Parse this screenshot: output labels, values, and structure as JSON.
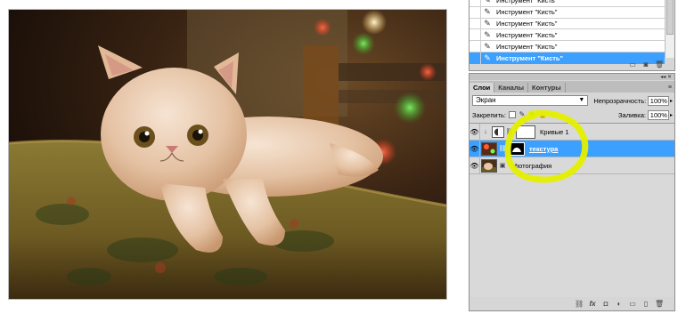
{
  "history": {
    "items": [
      {
        "label": "Инструмент \"Кисть\""
      },
      {
        "label": "Инструмент \"Кисть\""
      },
      {
        "label": "Инструмент \"Кисть\""
      },
      {
        "label": "Инструмент \"Кисть\""
      },
      {
        "label": "Инструмент \"Кисть\""
      },
      {
        "label": "Инструмент \"Кисть\""
      }
    ],
    "active_index": 5,
    "item_icon": "brush-icon"
  },
  "layers_panel": {
    "tabs": [
      {
        "label": "Слои",
        "active": true
      },
      {
        "label": "Каналы",
        "active": false
      },
      {
        "label": "Контуры",
        "active": false
      }
    ],
    "blend_mode": "Экран",
    "opacity_label": "Непрозрачность:",
    "opacity_value": "100%",
    "lock_label": "Закрепить:",
    "fill_label": "Заливка:",
    "fill_value": "100%",
    "layers": [
      {
        "name": "Кривые 1",
        "kind": "adjustment",
        "selected": false
      },
      {
        "name": "текстура",
        "kind": "image-with-mask",
        "selected": true
      },
      {
        "name": "фотография",
        "kind": "image",
        "selected": false
      }
    ],
    "footer_icons": [
      "link-icon",
      "fx-icon",
      "mask-icon",
      "adjustment-icon",
      "folder-icon",
      "new-layer-icon",
      "trash-icon"
    ]
  },
  "colors": {
    "selection_blue": "#3ba0ff",
    "panel_gray": "#d6d6d6",
    "marker_yellow": "#e4f000"
  }
}
